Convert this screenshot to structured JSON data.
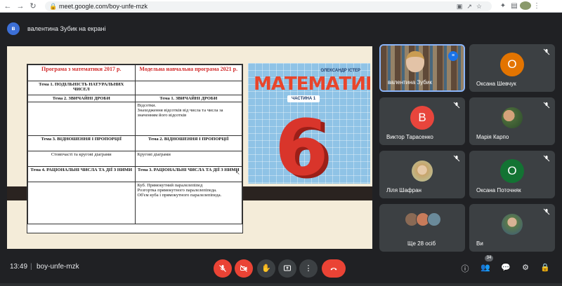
{
  "browser": {
    "url": "meet.google.com/boy-unfe-mzk"
  },
  "banner": {
    "avatar_letter": "в",
    "text": "валентина Зубик на екрані"
  },
  "document": {
    "header_left": "Програма з математики 2017 р.",
    "header_right": "Модельна навчальна програма 2021 р.",
    "rows": [
      {
        "left": "Тема 1. ПОДІЛЬНІСТЬ НАТУРАЛЬНИХ ЧИСЕЛ",
        "right": ""
      },
      {
        "left": "Тема 2. ЗВИЧАЙНІ ДРОБИ",
        "right": "Тема 1. ЗВИЧАЙНІ ДРОБИ"
      },
      {
        "left": "",
        "right": "Відсотки.\nЗнаходження відсотків від числа та числа за значенням його відсотків"
      },
      {
        "left": "Тема 3. ВІДНОШЕННЯ І ПРОПОРЦІЇ",
        "right": "Тема 2. ВІДНОШЕННЯ І ПРОПОРЦІЇ"
      },
      {
        "left": "Стовпчасті та кругові діаграми",
        "right": "Кругові діаграми"
      },
      {
        "left": "Тема 4. РАЦІОНАЛЬНІ ЧИСЛА ТА ДІЇ З НИМИ",
        "right": "Тема 3. РАЦІОНАЛЬНІ ЧИСЛА ТА ДІЇ З НИМИ"
      },
      {
        "left": "",
        "right": "Куб. Прямокутний паралелепіпед\nРозгортка прямокутного паралелепіпеда.\nОб'єм куба і прямокутного паралелепіпеда."
      }
    ]
  },
  "book": {
    "author": "ОЛЕКСАНДР ІСТЕР",
    "title": "МАТЕМАТИКА",
    "part": "ЧАСТИНА 1",
    "grade": "6"
  },
  "participants": {
    "presenter_name": "валентина Зубик",
    "oksana_sh": {
      "letter": "О",
      "name": "Оксана Шевчук",
      "color": "#e37400"
    },
    "viktor": {
      "letter": "В",
      "name": "Виктор Тарасенко",
      "color": "#e8453c"
    },
    "maria": {
      "name": "Марія Карпо"
    },
    "lilia": {
      "name": "Ліля Шафран"
    },
    "oksana_p": {
      "letter": "О",
      "name": "Оксана Поточняк",
      "color": "#137333"
    },
    "others": {
      "name": "Ще 28 осіб"
    },
    "self": {
      "name": "Ви"
    }
  },
  "bottombar": {
    "time": "13:49",
    "separator": "|",
    "meeting_code": "boy-unfe-mzk",
    "participant_count": "34"
  },
  "colors": {
    "danger": "#ea4335",
    "tile_bg": "#3c4043",
    "meet_bg": "#202124"
  }
}
